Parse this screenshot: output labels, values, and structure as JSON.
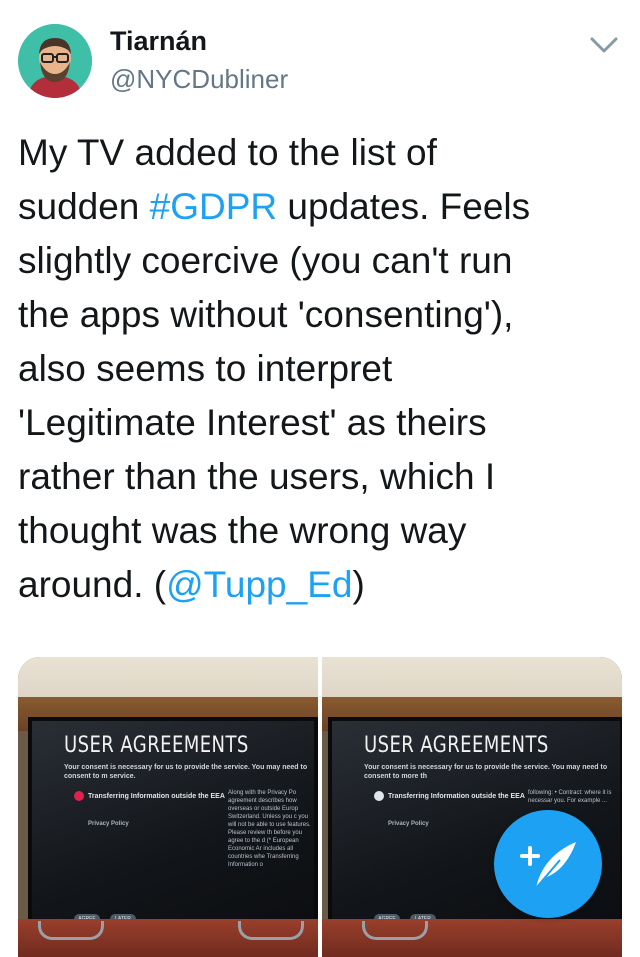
{
  "user": {
    "name": "Tiarnán",
    "handle": "@NYCDubliner"
  },
  "icons": {
    "avatar": "avatar-cartoon",
    "menu": "chevron-down-icon",
    "compose": "compose-tweet-icon"
  },
  "tweet": {
    "lines": [
      [
        "My TV added to the list of"
      ],
      [
        "sudden ",
        "#GDPR",
        " updates. Feels"
      ],
      [
        "slightly coercive (you can't run"
      ],
      [
        "the apps without 'consenting'),"
      ],
      [
        "also seems to interpret"
      ],
      [
        "'Legitimate Interest' as theirs"
      ],
      [
        "rather than the users, which I"
      ],
      [
        "thought was the wrong way"
      ],
      [
        "around. (",
        "@Tupp_Ed",
        ")"
      ]
    ]
  },
  "media": {
    "left": {
      "title": "USER AGREEMENTS",
      "consent": "Your consent is necessary for us to provide the service. You may need to consent to m service.",
      "item1": "Transferring Information outside the EEA",
      "item2": "Privacy Policy",
      "side": "Along with the Privacy Po agreement describes how overseas or outside Europ Switzerland. Unless you c you will not be able to use features. Please review th before you agree to the d (* European Economic Ar includes all countries whe Transferring Information o",
      "btn1": "AGREE",
      "btn2": "LATER"
    },
    "right": {
      "title": "USER AGREEMENTS",
      "consent": "Your consent is necessary for us to provide the service. You may need to consent to more th",
      "item1": "Transferring Information outside the EEA",
      "item2": "Privacy Policy",
      "side": "following: • Contract: where it is necessar you. For example ...",
      "btn1": "AGREE",
      "btn2": "LATER"
    }
  },
  "colors": {
    "link": "#1da1f2",
    "text": "#14171a",
    "muted": "#657786",
    "fab": "#1da1f2"
  }
}
